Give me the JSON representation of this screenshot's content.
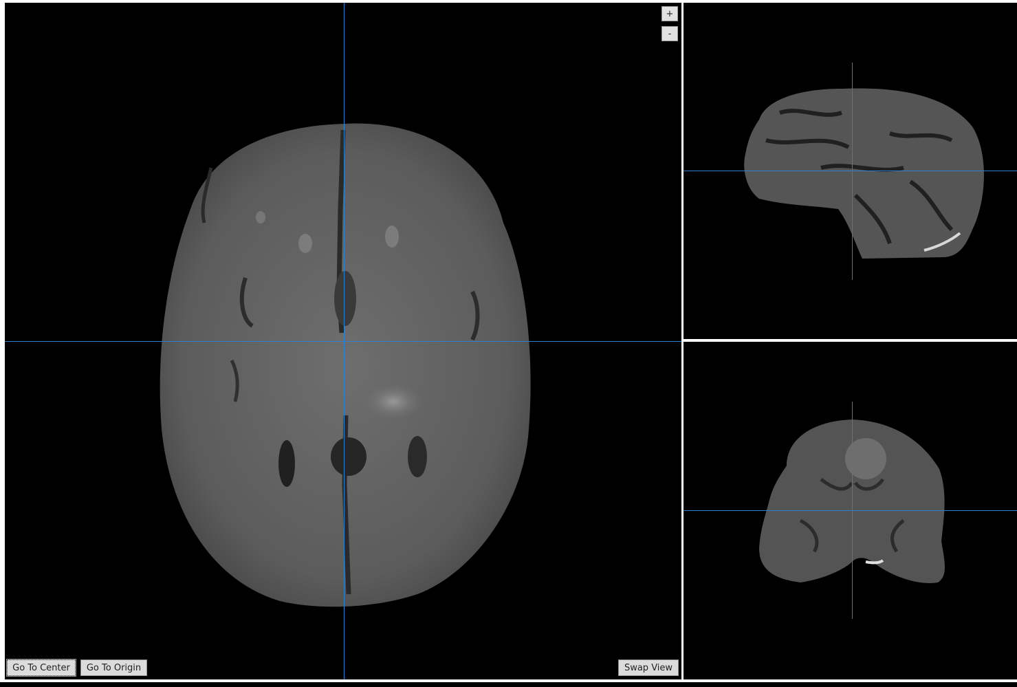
{
  "controls": {
    "zoom_in_label": "+",
    "zoom_out_label": "-",
    "go_to_center_label": "Go To Center",
    "go_to_origin_label": "Go To Origin",
    "swap_view_label": "Swap View"
  },
  "views": {
    "main": "axial-slice",
    "top_right": "sagittal-slice",
    "bottom_right": "coronal-slice"
  },
  "colors": {
    "background": "#000000",
    "crosshair": "#2f7fd0",
    "button_face": "#dcdcdc"
  }
}
